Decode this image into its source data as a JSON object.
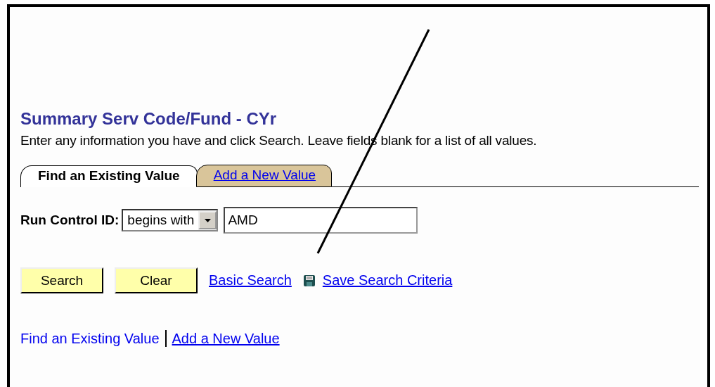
{
  "page": {
    "title": "Summary Serv Code/Fund - CYr",
    "instructions": "Enter any information you have and click Search. Leave fields blank for a list of all values."
  },
  "tabs": [
    {
      "label": "Find an Existing Value",
      "selected": true
    },
    {
      "label": "Add a New Value",
      "selected": false
    }
  ],
  "search_form": {
    "label": "Run Control ID:",
    "operator": "begins with",
    "value": "AMD"
  },
  "actions": [
    {
      "kind": "button",
      "label": "Search"
    },
    {
      "kind": "button",
      "label": "Clear"
    },
    {
      "kind": "link",
      "label": "Basic Search"
    },
    {
      "kind": "icon-link",
      "label": "Save Search Criteria"
    }
  ],
  "footer_links": [
    {
      "label": "Find an Existing Value",
      "selected": true
    },
    {
      "label": "Add a New Value",
      "selected": false
    }
  ]
}
